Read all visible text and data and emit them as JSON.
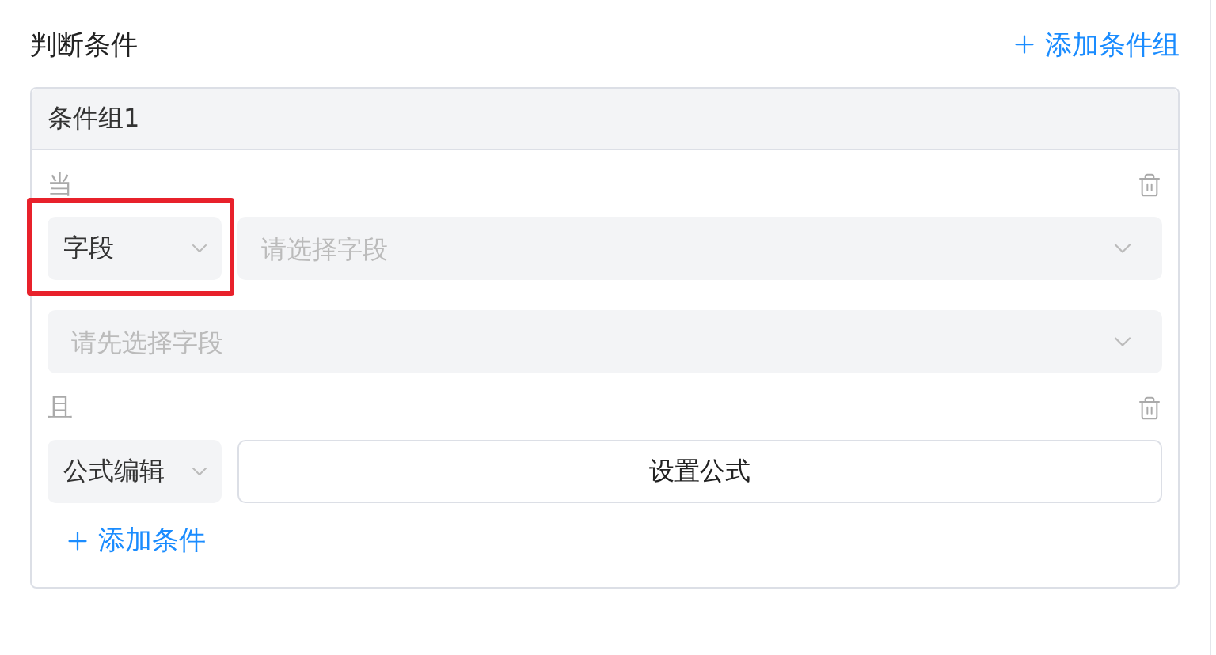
{
  "title": "判断条件",
  "add_group": {
    "label": "添加条件组"
  },
  "groups": [
    {
      "title": "条件组1",
      "conditions": [
        {
          "connector": "当",
          "kind": "field",
          "type_select": {
            "value": "字段",
            "highlighted": true
          },
          "field_select": {
            "placeholder": "请选择字段"
          },
          "value_select": {
            "placeholder": "请先选择字段"
          }
        },
        {
          "connector": "且",
          "kind": "formula",
          "type_select": {
            "value": "公式编辑",
            "highlighted": false
          },
          "button": "设置公式"
        }
      ],
      "add_condition": {
        "label": "添加条件"
      }
    }
  ]
}
